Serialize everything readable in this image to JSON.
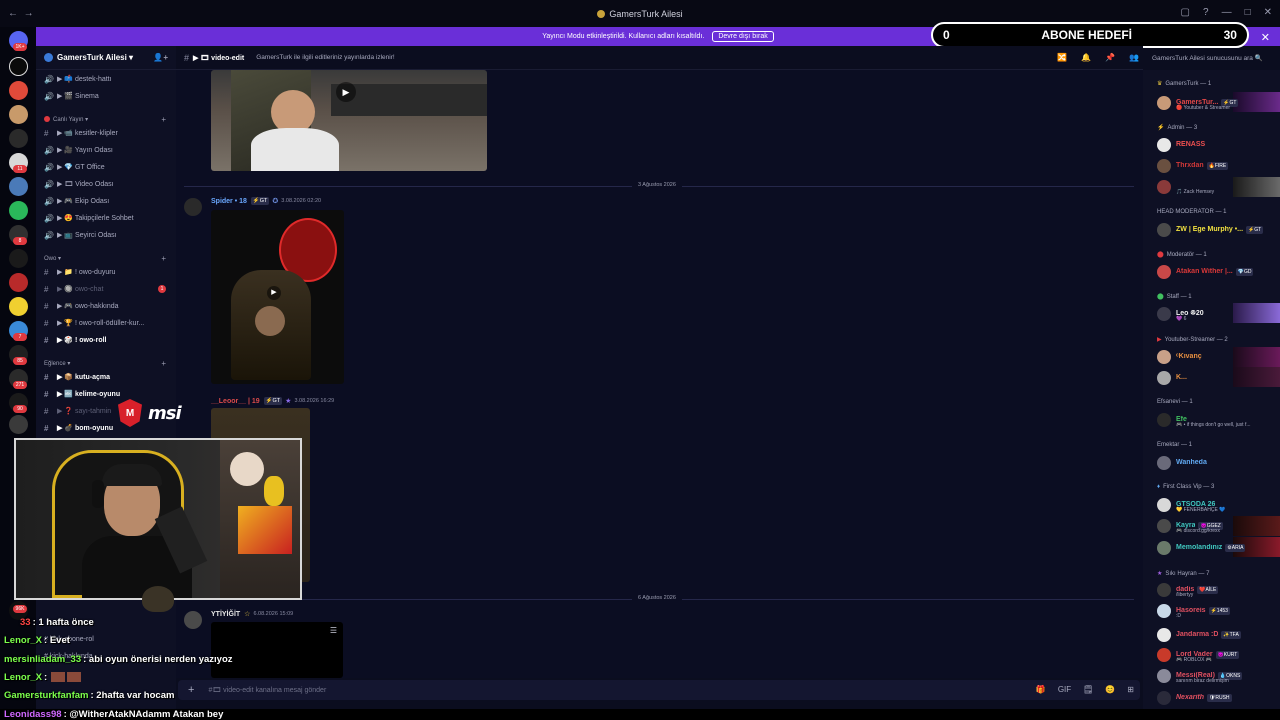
{
  "window": {
    "title": "GamersTurk Ailesi",
    "nav_back": "←",
    "nav_fwd": "→",
    "controls": [
      "▢",
      "?",
      "—",
      "□",
      "✕"
    ]
  },
  "streamer_bar": {
    "text": "Yayıncı Modu etkinleştirildi. Kullanıcı adları kısaltıldı.",
    "button": "Devre dışı bırak",
    "close": "✕"
  },
  "goal_overlay": {
    "current": "0",
    "label": "ABONE HEDEFİ",
    "target": "30"
  },
  "server_rail": {
    "badges": [
      "1K+",
      "11",
      "8",
      "2",
      "4",
      "7",
      "85",
      "271",
      "90",
      "3",
      "96K",
      "8",
      "86",
      "20"
    ]
  },
  "server": {
    "name": "GamersTurk Ailesi ▾",
    "add_member_icon": "👤+"
  },
  "sidebar": {
    "channels_top": [
      {
        "icon": "🔊",
        "label": "▶ 📫 destek-hattı"
      },
      {
        "icon": "🔊",
        "label": "▶ 🎬 Sinema"
      }
    ],
    "cat_live": "Canlı Yayın ▾",
    "channels_live": [
      {
        "icon": "#",
        "label": "▶ 📹 kesitler-klipler"
      },
      {
        "icon": "🔊",
        "label": "▶ 🎥 Yayın Odası"
      },
      {
        "icon": "🔊",
        "label": "▶ 💎 GT Office"
      },
      {
        "icon": "🔊",
        "label": "▶ 🎞 Video Odası"
      },
      {
        "icon": "🔊",
        "label": "▶ 🎮 Ekip Odası"
      },
      {
        "icon": "🔊",
        "label": "▶ 😍 Takipçilerle Sohbet"
      },
      {
        "icon": "🔊",
        "label": "▶ 📺 Seyirci Odası"
      }
    ],
    "cat_owo": "Owo ▾",
    "channels_owo": [
      {
        "icon": "#",
        "label": "▶ 📁 ! owo-duyuru",
        "style": ""
      },
      {
        "icon": "#",
        "label": "▶ 🔘 owo-chat",
        "style": "muted",
        "badge": "1"
      },
      {
        "icon": "#",
        "label": "▶ 🎮 owo-hakkında",
        "style": ""
      },
      {
        "icon": "#",
        "label": "▶ 🏆 ! owo-roll-ödüller-kur...",
        "style": ""
      },
      {
        "icon": "#",
        "label": "▶ 🎲 ! owo-roll",
        "style": "bold"
      }
    ],
    "cat_fun": "Eğlence ▾",
    "channels_fun": [
      {
        "icon": "#",
        "label": "▶ 📦 kutu-açma",
        "style": "bold"
      },
      {
        "icon": "#",
        "label": "▶ 🔤 kelime-oyunu",
        "style": "bold"
      },
      {
        "icon": "#",
        "label": "▶ ❓ sayı-tahmin",
        "style": "muted"
      },
      {
        "icon": "#",
        "label": "▶ 💣 bom-oyunu",
        "style": "bold"
      }
    ],
    "plus": "+"
  },
  "channel": {
    "name": "▶ 🎞 video-edit",
    "topic": "GamersTurk ile ilgili editleriniz yayınlarda izlenir!",
    "header_icons": [
      "🔀",
      "🔔",
      "📌",
      "👥"
    ],
    "search_placeholder": "GamersTurk Ailesi sunucusunu ara 🔍"
  },
  "messages": {
    "date_1": "3 Ağustos 2026",
    "date_2": "6 Ağustos 2026",
    "msg1": {
      "user": "Spider • 18",
      "tag": "⚡GT",
      "badge": "✪",
      "time": "3.08.2026 02:20"
    },
    "msg2": {
      "user": "__Leoor__ | 19",
      "tag": "⚡GT",
      "badge": "★",
      "time": "3.08.2026 16:29"
    },
    "msg3": {
      "user": "YTİYİĞİT",
      "badge": "☆",
      "time": "6.08.2026 15:09"
    },
    "video_play": "▶"
  },
  "composer": {
    "plus": "+",
    "placeholder": "#🎞 video-edit kanalına mesaj gönder",
    "icons": [
      "🎁",
      "GIF",
      "🗒",
      "😊",
      "⊞"
    ]
  },
  "members": {
    "cat_gamersturk": "GamersTurk — 1",
    "m_gamersturk": {
      "name": "GamersTur...",
      "tag": "⚡GT",
      "status": "🔴 Youtuber & Streamer",
      "color": "#e04848"
    },
    "cat_admin": "Admin — 3",
    "m_admin": [
      {
        "name": "RENASS",
        "tag": "",
        "status": "",
        "color": "#f05050"
      },
      {
        "name": "Thrxdan",
        "tag": "🔥FIRE",
        "status": "",
        "color": "#d03838"
      },
      {
        "name": "",
        "tag": "",
        "status": "🎵 Zack Hemsey",
        "color": "#d03838"
      }
    ],
    "cat_head": "HEAD MODERATOR — 1",
    "m_head": {
      "name": "ZW | Ege Murphy •...",
      "tag": "⚡GT",
      "status": "",
      "color": "#f0e040"
    },
    "cat_mod": "Moderatör — 1",
    "m_mod": {
      "name": "Atakan Wither |...",
      "tag": "💎GD",
      "status": "",
      "color": "#d83838"
    },
    "cat_staff": "Staff — 1",
    "m_staff": {
      "name": "Leo ꔮ20",
      "tag": "",
      "status": "💜 6",
      "color": "#f0f0f0"
    },
    "cat_yt": "Youtuber-Streamer — 2",
    "m_yt": [
      {
        "name": "ᶜKıvanç",
        "tag": "",
        "status": "",
        "color": "#e89040"
      },
      {
        "name": "K...",
        "tag": "",
        "status": "",
        "color": "#e89040"
      }
    ],
    "cat_efs": "Efsanevi — 1",
    "m_efs": {
      "name": "Efe",
      "tag": "",
      "status": "🎮 • if things don't go well, just f...",
      "color": "#40c060"
    },
    "cat_emek": "Emektar — 1",
    "m_emek": {
      "name": "Wanheda",
      "tag": "",
      "status": "",
      "color": "#60a8f0"
    },
    "cat_fcv": "First Class Vip — 3",
    "m_fcv": [
      {
        "name": "GTSODA 26",
        "tag": "",
        "status": "💛 FENERBAHÇE 💙",
        "color": "#40c8c0"
      },
      {
        "name": "Kayra",
        "tag": "😈GGEZ",
        "status": "🎮 discord.gg/krexx",
        "color": "#40c8c0"
      },
      {
        "name": "Memolandınız",
        "tag": "⚙ARIA",
        "status": "",
        "color": "#40c8c0"
      }
    ],
    "cat_siki": "Sıkı Hayran — 7",
    "m_siki": [
      {
        "name": "dadis",
        "tag": "❤️AİLE",
        "status": "/libertyy",
        "color": "#e05060"
      },
      {
        "name": "Hasoreis",
        "tag": "⚡1453",
        "status": ":D",
        "color": "#e05060"
      },
      {
        "name": "Jandarma :D",
        "tag": "✨TFA",
        "status": "",
        "color": "#e05060"
      },
      {
        "name": "Lord Vader",
        "tag": "😈KURT",
        "status": "🎮 ROBLOX 🎮",
        "color": "#e05060"
      },
      {
        "name": "Messi(Real)",
        "tag": "💧OKNS",
        "status": "sanırım biraz delirmişim",
        "color": "#e05060"
      },
      {
        "name": "Nexarith",
        "tag": "🛡RUSH",
        "status": "",
        "color": "#e05060"
      }
    ]
  },
  "overlay": {
    "msi_mark": "M",
    "msi_text": "msi",
    "chat": [
      {
        "user": "33",
        "text": ": 1 hafta önce",
        "color": "#ff4444"
      },
      {
        "user": "Lenor_X",
        "text": ": Evet",
        "color": "#7cff4c"
      },
      {
        "user": "mersinliadam_33",
        "text": ": abi oyun önerisi nerden yazıyoz",
        "color": "#7cff4c"
      },
      {
        "user": "Lenor_X",
        "text": ":",
        "color": "#7cff4c"
      },
      {
        "user": "Gamersturkfanfam",
        "text": ": 2hafta var hocam",
        "color": "#7cff4c"
      },
      {
        "user": "Leonidass98",
        "text": ": @WitherAtakNAdamm Atakan bey",
        "color": "#d068ff"
      }
    ],
    "behind_text_1": "# kick-abone-rol",
    "behind_text_2": "# kick-hakkında"
  }
}
